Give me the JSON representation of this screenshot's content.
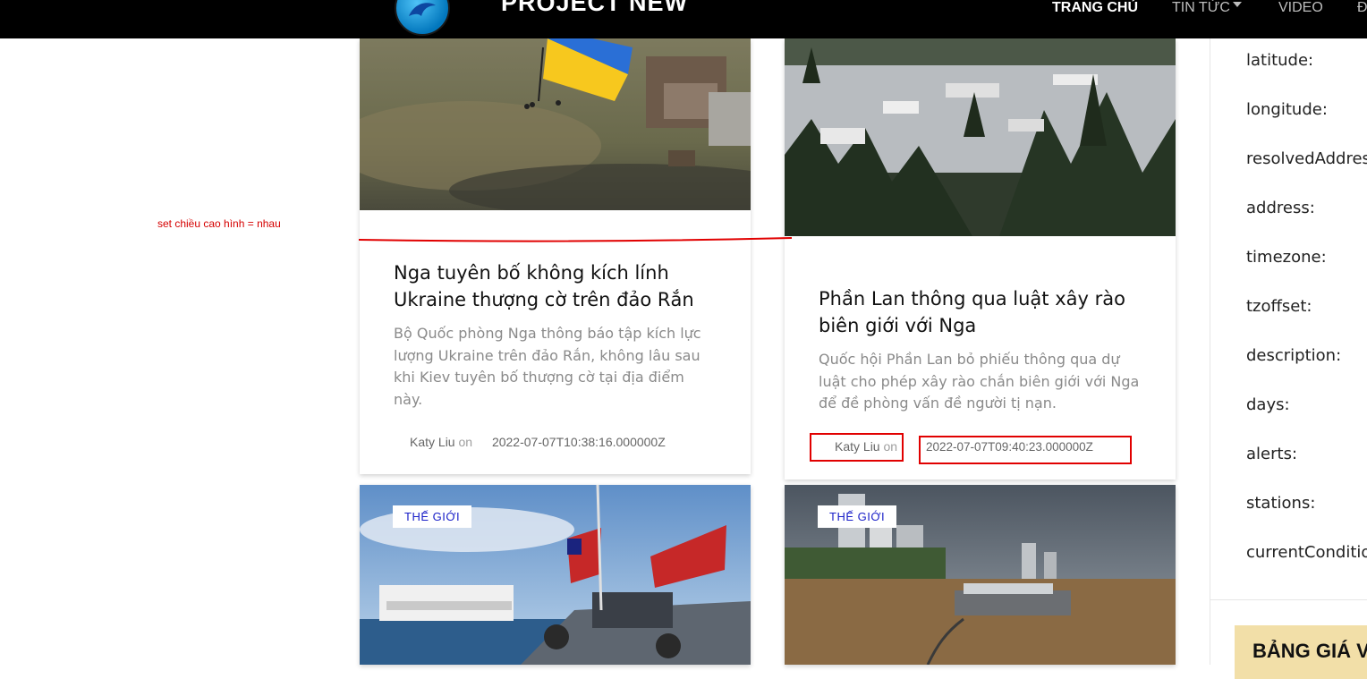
{
  "header": {
    "brand": "PROJECT NEW",
    "nav": [
      {
        "label": "TRANG CHỦ"
      },
      {
        "label": "TIN TỨC"
      },
      {
        "label": "VIDEO"
      },
      {
        "label": "Đ"
      }
    ]
  },
  "annotation": {
    "text": "set chiều cao hình = nhau"
  },
  "cards": [
    {
      "title": "Nga tuyên bố không kích lính Ukraine thượng cờ trên đảo Rắn",
      "excerpt": "Bộ Quốc phòng Nga thông báo tập kích lực lượng Ukraine trên đảo Rắn, không lâu sau khi Kiev tuyên bố thượng cờ tại địa điểm này.",
      "author": "Katy Liu",
      "on": "on",
      "date": "2022-07-07T10:38:16.000000Z"
    },
    {
      "title": "Phần Lan thông qua luật xây rào biên giới với Nga",
      "excerpt": "Quốc hội Phần Lan bỏ phiếu thông qua dự luật cho phép xây rào chắn biên giới với Nga để đề phòng vấn đề người tị nạn.",
      "author": "Katy Liu",
      "on": "on",
      "date": "2022-07-07T09:40:23.000000Z"
    },
    {
      "tag": "THẾ GIỚI"
    },
    {
      "tag": "THẾ GIỚI"
    }
  ],
  "weather_panel": {
    "fields": [
      "latitude:",
      "longitude:",
      "resolvedAddress:",
      "address:",
      "timezone:",
      "tzoffset:",
      "description:",
      "days:",
      "alerts:",
      "stations:",
      "currentConditions:"
    ],
    "price_title": "BẢNG GIÁ VÀNG"
  },
  "colors": {
    "accent_red": "#e10000",
    "tag_text": "#1a20c8",
    "price_bg": "#f2dfa8"
  }
}
